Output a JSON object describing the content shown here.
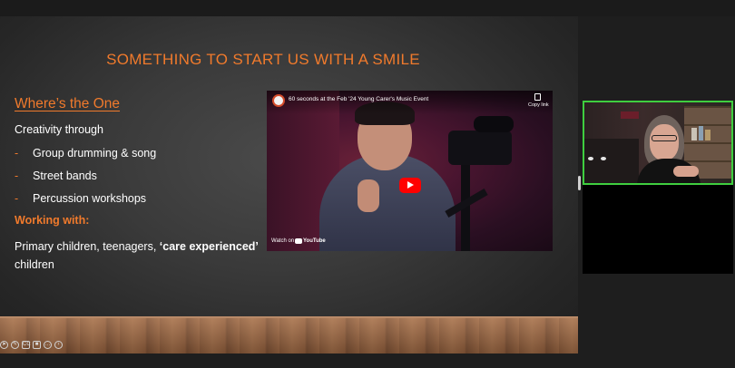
{
  "slide": {
    "title": "SOMETHING TO START US WITH A SMILE",
    "heading": "Where’s the One",
    "intro": "Creativity through",
    "bullets": [
      {
        "marker": "-",
        "text": "Group drumming & song"
      },
      {
        "marker": "-",
        "text": "Street bands"
      },
      {
        "marker": "-",
        "text": "Percussion workshops"
      }
    ],
    "working_label": "Working with:",
    "desc_plain": "Primary children, teenagers, ",
    "desc_bold": "‘care experienced’",
    "desc_end": " children"
  },
  "video": {
    "title": "60 seconds at the Feb '24 Young Carer's Music Event",
    "copy_link": "Copy link",
    "watch_on": "Watch on",
    "platform": "YouTube"
  },
  "controls": {
    "icons": [
      "pointer-icon",
      "pen-icon",
      "subtitles-icon",
      "camera-icon",
      "more-icon",
      "next-icon"
    ]
  },
  "colors": {
    "accent": "#f07a2c",
    "active_speaker_border": "#3fce3f",
    "play_button": "#ff0000"
  }
}
